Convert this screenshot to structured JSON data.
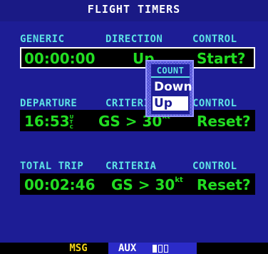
{
  "title": "FLIGHT TIMERS",
  "generic": {
    "headers": [
      "GENERIC",
      "DIRECTION",
      "CONTROL"
    ],
    "time": "00:00:00",
    "direction": "Up",
    "control": "Start?"
  },
  "departure": {
    "headers": [
      "DEPARTURE",
      "CRITERIA",
      "CONTROL"
    ],
    "time": "16:53",
    "time_unit": "UTC",
    "criteria_prefix": "GS > ",
    "criteria_value": "30",
    "criteria_unit": "kt",
    "control": "Reset?"
  },
  "total_trip": {
    "headers": [
      "TOTAL TRIP",
      "CRITERIA",
      "CONTROL"
    ],
    "time": "00:02:46",
    "criteria_prefix": "GS > ",
    "criteria_value": "30",
    "criteria_unit": "kt",
    "control": "Reset?"
  },
  "popup": {
    "title": "COUNT",
    "options": [
      "Down",
      "Up"
    ],
    "selected": "Up"
  },
  "bottom": {
    "msg": "MSG",
    "aux": "AUX"
  },
  "colors": {
    "background": "#1d1d95",
    "header": "#5ee3e6",
    "value": "#22dd22",
    "msg": "#f2d21a"
  }
}
